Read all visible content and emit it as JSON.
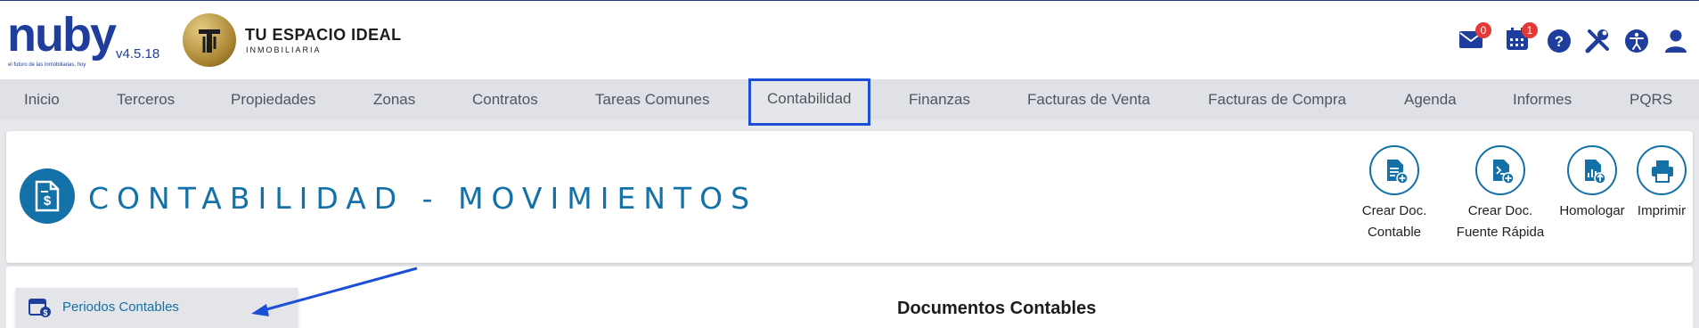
{
  "brand": {
    "name": "nuby",
    "version": "v4.5.18",
    "tagline": "el futuro de las inmobiliarias, hoy",
    "client_name": "TU ESPACIO IDEAL",
    "client_subtitle": "INMOBILIARIA"
  },
  "top_icons": [
    {
      "name": "mail-icon",
      "badge": "0"
    },
    {
      "name": "calendar-icon",
      "badge": "1"
    },
    {
      "name": "help-icon",
      "badge": ""
    },
    {
      "name": "tools-icon",
      "badge": ""
    },
    {
      "name": "accessibility-icon",
      "badge": ""
    },
    {
      "name": "user-icon",
      "badge": ""
    }
  ],
  "nav": {
    "items": [
      "Inicio",
      "Terceros",
      "Propiedades",
      "Zonas",
      "Contratos",
      "Tareas Comunes",
      "Contabilidad",
      "Finanzas",
      "Facturas de Venta",
      "Facturas de Compra",
      "Agenda",
      "Informes",
      "PQRS"
    ],
    "active": "Contabilidad"
  },
  "page": {
    "title": "CONTABILIDAD - MOVIMIENTOS",
    "icon": "invoice-dollar-icon"
  },
  "actions": [
    {
      "line1": "Crear Doc.",
      "line2": "Contable",
      "icon": "file-add-icon"
    },
    {
      "line1": "Crear Doc.",
      "line2": "Fuente Rápida",
      "icon": "file-add-fast-icon"
    },
    {
      "line1": "Homologar",
      "line2": "",
      "icon": "file-chart-upload-icon"
    },
    {
      "line1": "Imprimir",
      "line2": "",
      "icon": "printer-icon"
    }
  ],
  "side_menu": {
    "items": [
      {
        "label": "Periodos Contables",
        "icon": "calendar-dollar-icon"
      }
    ]
  },
  "section": {
    "title": "Documentos Contables"
  },
  "colors": {
    "brand_blue": "#1f3d9c",
    "accent": "#1471a7",
    "highlight": "#1a4fd6",
    "badge": "#e53935"
  }
}
